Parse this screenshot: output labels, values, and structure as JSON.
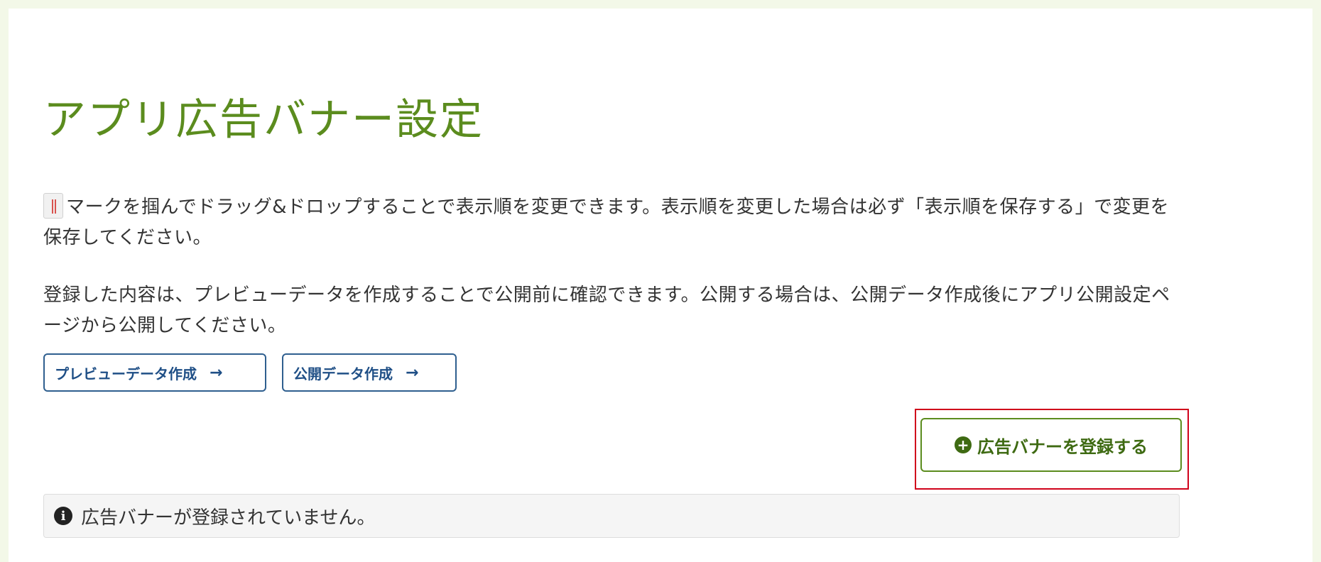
{
  "page": {
    "title": "アプリ広告バナー設定"
  },
  "instructions": {
    "reorder_text": "マークを掴んでドラッグ&ドロップすることで表示順を変更できます。表示順を変更した場合は必ず「表示順を保存する」で変更を保存してください。",
    "publish_text": "登録した内容は、プレビューデータを作成することで公開前に確認できます。公開する場合は、公開データ作成後にアプリ公開設定ページから公開してください。"
  },
  "actions": {
    "preview_label": "プレビューデータ作成",
    "publish_label": "公開データ作成",
    "arrow_icon": "→",
    "register_label": "広告バナーを登録する",
    "plus_icon": "+"
  },
  "alert": {
    "message": "広告バナーが登録されていません。",
    "info_icon": "i"
  },
  "colors": {
    "title": "#5b8c1e",
    "outline_button": "#2f5f8f",
    "register_button": "#5b8c1e",
    "highlight": "#d0021b",
    "page_background": "#f3f8e8"
  }
}
